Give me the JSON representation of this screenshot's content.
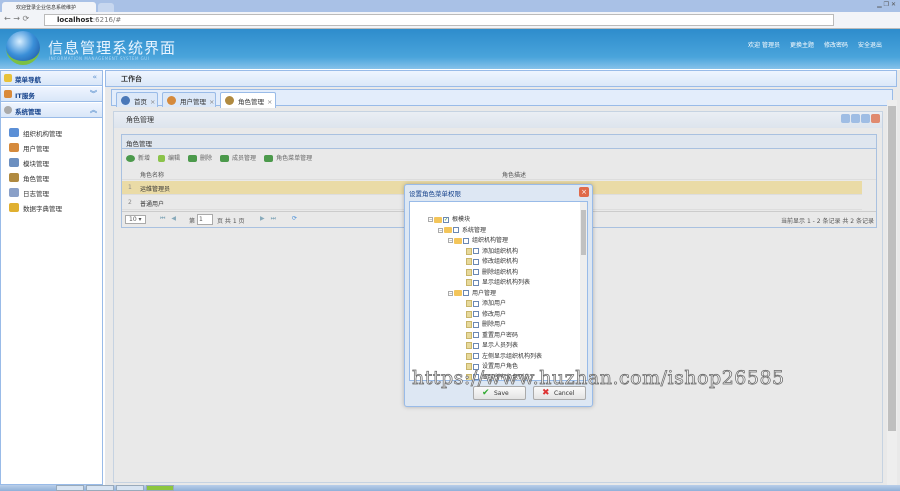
{
  "browser": {
    "tab_title": "欢迎登录企业信息系统维护",
    "url_host": "localhost",
    "url_rest": ":6216/#"
  },
  "header": {
    "title": "信息管理系统界面",
    "subtitle": "INFORMATION MANAGEMENT SYSTEM GUI",
    "links": [
      "欢迎 管理员",
      "更换主题",
      "修改密码",
      "安全退出"
    ]
  },
  "sidebar": {
    "sections": [
      {
        "label": "菜单导航",
        "chevron": "«"
      },
      {
        "label": "IT服务",
        "chevron": "︾"
      },
      {
        "label": "系统管理",
        "chevron": "︽"
      }
    ],
    "items": [
      {
        "label": "组织机构管理",
        "color": "#5b8fd6"
      },
      {
        "label": "用户管理",
        "color": "#d58a3c"
      },
      {
        "label": "模块管理",
        "color": "#6c8fc0"
      },
      {
        "label": "角色管理",
        "color": "#b08a40"
      },
      {
        "label": "日志管理",
        "color": "#8aa0c8"
      },
      {
        "label": "数据字典管理",
        "color": "#e0b030"
      }
    ]
  },
  "main": {
    "workbench_title": "工作台",
    "tabs": [
      {
        "label": "首页"
      },
      {
        "label": "用户管理"
      },
      {
        "label": "角色管理"
      }
    ],
    "panel_title": "角色管理",
    "grid": {
      "title": "角色管理",
      "toolbar": [
        "新增",
        "编辑",
        "删除",
        "成员管理",
        "角色菜单管理"
      ],
      "columns": [
        "角色名称",
        "角色描述"
      ],
      "rows": [
        {
          "num": "1",
          "name": "运维管理员",
          "selected": true
        },
        {
          "num": "2",
          "name": "普通用户",
          "selected": false
        }
      ],
      "pager": {
        "page_size": "10",
        "page_label": "第",
        "page": "1",
        "total_label": "页 共 1 页",
        "summary": "当前显示 1 - 2 条记录 共 2 条记录"
      }
    }
  },
  "dialog": {
    "title": "设置角色菜单权限",
    "tree": [
      {
        "label": "根模块",
        "level": 0,
        "type": "folder",
        "checked": true
      },
      {
        "label": "系统管理",
        "level": 1,
        "type": "folder",
        "checked": false
      },
      {
        "label": "组织机构管理",
        "level": 2,
        "type": "folder",
        "checked": false
      },
      {
        "label": "添加组织机构",
        "level": 3,
        "type": "leaf",
        "checked": false
      },
      {
        "label": "修改组织机构",
        "level": 3,
        "type": "leaf",
        "checked": false
      },
      {
        "label": "删除组织机构",
        "level": 3,
        "type": "leaf",
        "checked": false
      },
      {
        "label": "显示组织机构列表",
        "level": 3,
        "type": "leaf",
        "checked": false
      },
      {
        "label": "用户管理",
        "level": 2,
        "type": "folder",
        "checked": false
      },
      {
        "label": "添加用户",
        "level": 3,
        "type": "leaf",
        "checked": false
      },
      {
        "label": "修改用户",
        "level": 3,
        "type": "leaf",
        "checked": false
      },
      {
        "label": "删除用户",
        "level": 3,
        "type": "leaf",
        "checked": false
      },
      {
        "label": "重置用户密码",
        "level": 3,
        "type": "leaf",
        "checked": false
      },
      {
        "label": "显示人员列表",
        "level": 3,
        "type": "leaf",
        "checked": false
      },
      {
        "label": "左侧显示组织机构列表",
        "level": 3,
        "type": "leaf",
        "checked": false
      },
      {
        "label": "设置用户角色",
        "level": 3,
        "type": "leaf",
        "checked": false
      },
      {
        "label": "显示所有角色列表",
        "level": 3,
        "type": "leaf",
        "checked": false
      }
    ],
    "save_label": "Save",
    "cancel_label": "Cancel"
  },
  "watermark": "https://www.huzhan.com/ishop26585"
}
